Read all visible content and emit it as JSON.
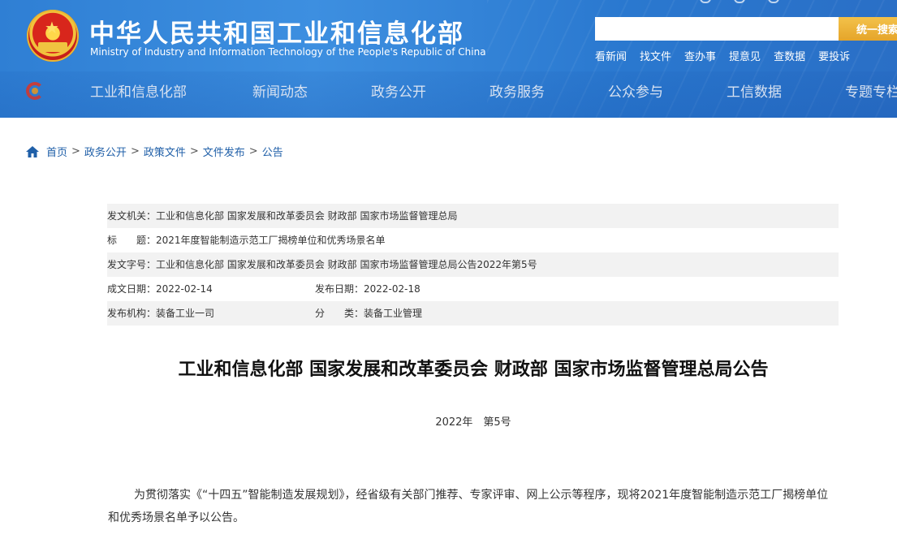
{
  "header": {
    "title": "中华人民共和国工业和信息化部",
    "subtitle": "Ministry of Industry and Information Technology of the People's Republic of China",
    "search": {
      "placeholder": "",
      "button_label": "统一搜索"
    },
    "quick_links": [
      "看新闻",
      "找文件",
      "查办事",
      "提意见",
      "查数据",
      "要投诉"
    ]
  },
  "nav": {
    "items": [
      "工业和信息化部",
      "新闻动态",
      "政务公开",
      "政务服务",
      "公众参与",
      "工信数据",
      "专题专栏"
    ]
  },
  "breadcrumb": [
    "首页",
    "政务公开",
    "政策文件",
    "文件发布",
    "公告"
  ],
  "meta": {
    "issuer_label": "发文机关：",
    "issuer": "工业和信息化部 国家发展和改革委员会 财政部 国家市场监督管理总局",
    "title_label": "标　　题：",
    "title": "2021年度智能制造示范工厂揭榜单位和优秀场景名单",
    "doc_no_label": "发文字号：",
    "doc_no": "工业和信息化部 国家发展和改革委员会 财政部 国家市场监督管理总局公告2022年第5号",
    "date_written_label": "成文日期：",
    "date_written": "2022-02-14",
    "date_published_label": "发布日期：",
    "date_published": "2022-02-18",
    "publisher_label": "发布机构：",
    "publisher": "装备工业一司",
    "category_label": "分　　类：",
    "category": "装备工业管理"
  },
  "article": {
    "title": "工业和信息化部 国家发展和改革委员会 财政部 国家市场监督管理总局公告",
    "number": "2022年　第5号",
    "paragraph": "为贯彻落实《“十四五”智能制造发展规划》，经省级有关部门推荐、专家评审、网上公示等程序，现将2021年度智能制造示范工厂揭榜单位和优秀场景名单予以公告。"
  }
}
